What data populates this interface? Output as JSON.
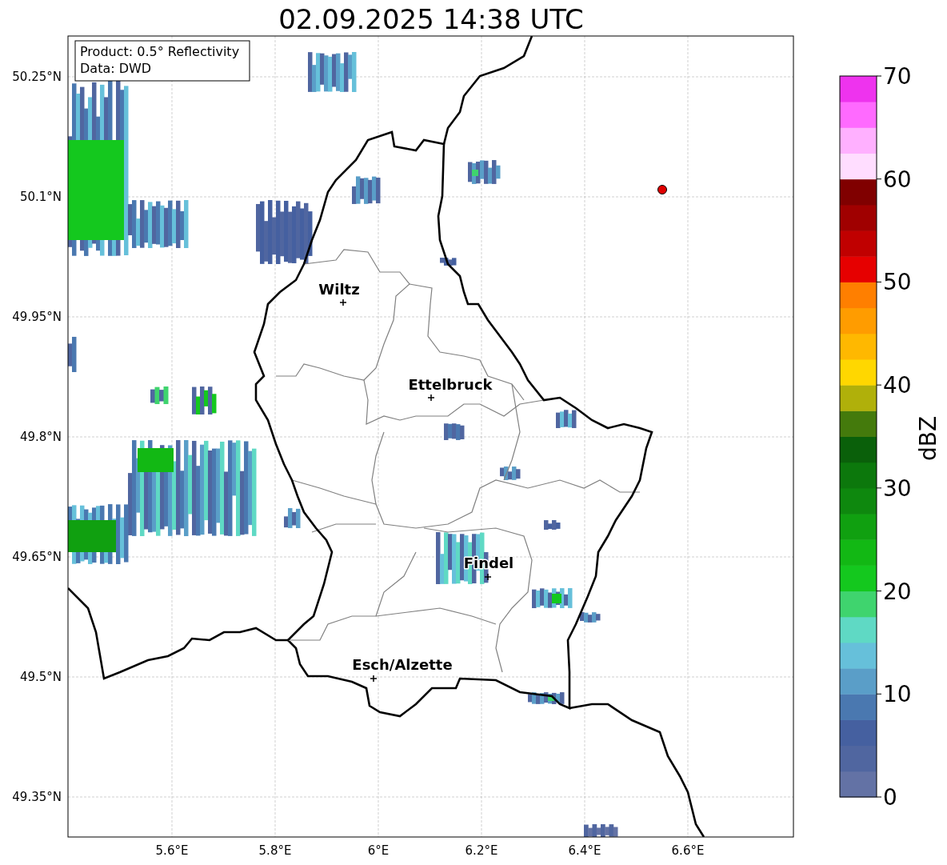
{
  "title": "02.09.2025 14:38 UTC",
  "info_box": [
    "Product: 0.5° Reflectivity",
    "Data: DWD"
  ],
  "y_ticks": [
    "50.25°N",
    "50.1°N",
    "49.95°N",
    "49.8°N",
    "49.65°N",
    "49.5°N",
    "49.35°N"
  ],
  "x_ticks": [
    "5.6°E",
    "5.8°E",
    "6°E",
    "6.2°E",
    "6.4°E",
    "6.6°E"
  ],
  "cities": [
    {
      "name": "Wiltz"
    },
    {
      "name": "Ettelbruck"
    },
    {
      "name": "Findel"
    },
    {
      "name": "Esch/Alzette"
    }
  ],
  "colorbar": {
    "label": "dBZ",
    "ticks": [
      "70",
      "60",
      "50",
      "40",
      "30",
      "20",
      "10",
      "0"
    ],
    "bins": [
      {
        "color": "#6372a5"
      },
      {
        "color": "#5066a0"
      },
      {
        "color": "#4560a0"
      },
      {
        "color": "#4a78b0"
      },
      {
        "color": "#5a9ec8"
      },
      {
        "color": "#66c0da"
      },
      {
        "color": "#5fd9c4"
      },
      {
        "color": "#3fd46e"
      },
      {
        "color": "#14c81e"
      },
      {
        "color": "#12b814"
      },
      {
        "color": "#10a010"
      },
      {
        "color": "#0e880e"
      },
      {
        "color": "#0c780c"
      },
      {
        "color": "#0a600a"
      },
      {
        "color": "#447a0c"
      },
      {
        "color": "#b0b00a"
      },
      {
        "color": "#ffd700"
      },
      {
        "color": "#ffb800"
      },
      {
        "color": "#ff9c00"
      },
      {
        "color": "#ff7f00"
      },
      {
        "color": "#e60000"
      },
      {
        "color": "#c00000"
      },
      {
        "color": "#a00000"
      },
      {
        "color": "#800000"
      },
      {
        "color": "#ffddff"
      },
      {
        "color": "#ffb0ff"
      },
      {
        "color": "#ff6aff"
      },
      {
        "color": "#ee33ee"
      }
    ]
  }
}
